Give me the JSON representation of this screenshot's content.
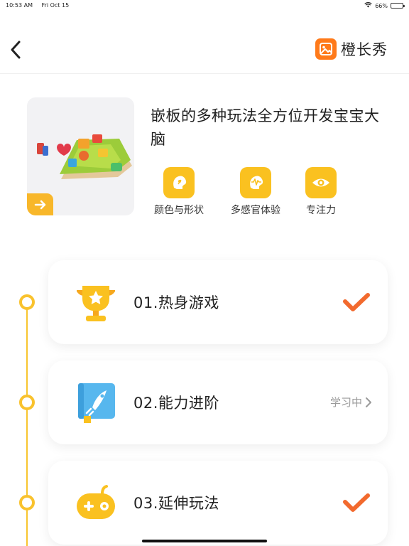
{
  "status_bar": {
    "time": "10:53 AM",
    "date": "Fri Oct 15",
    "battery_text": "66%",
    "battery_level": 0.66
  },
  "nav": {
    "brand_name": "橙长秀",
    "brand_color": "#ff7a1a"
  },
  "hero": {
    "title": "嵌板的多种玩法全方位开发宝宝大脑",
    "tags": [
      {
        "label": "颜色与形状",
        "icon": "color-shape-icon"
      },
      {
        "label": "多感官体验",
        "icon": "multi-sense-icon"
      },
      {
        "label": "专注力",
        "icon": "eye-icon"
      }
    ]
  },
  "steps": [
    {
      "title": "01.热身游戏",
      "icon": "trophy-icon",
      "state": "completed"
    },
    {
      "title": "02.能力进阶",
      "icon": "book-icon",
      "state": "in-progress",
      "status_label": "学习中"
    },
    {
      "title": "03.延伸玩法",
      "icon": "game-controller-icon",
      "state": "completed"
    }
  ],
  "colors": {
    "accent": "#fac120",
    "check": "#f26a2e",
    "timeline": "#f8c52e"
  }
}
